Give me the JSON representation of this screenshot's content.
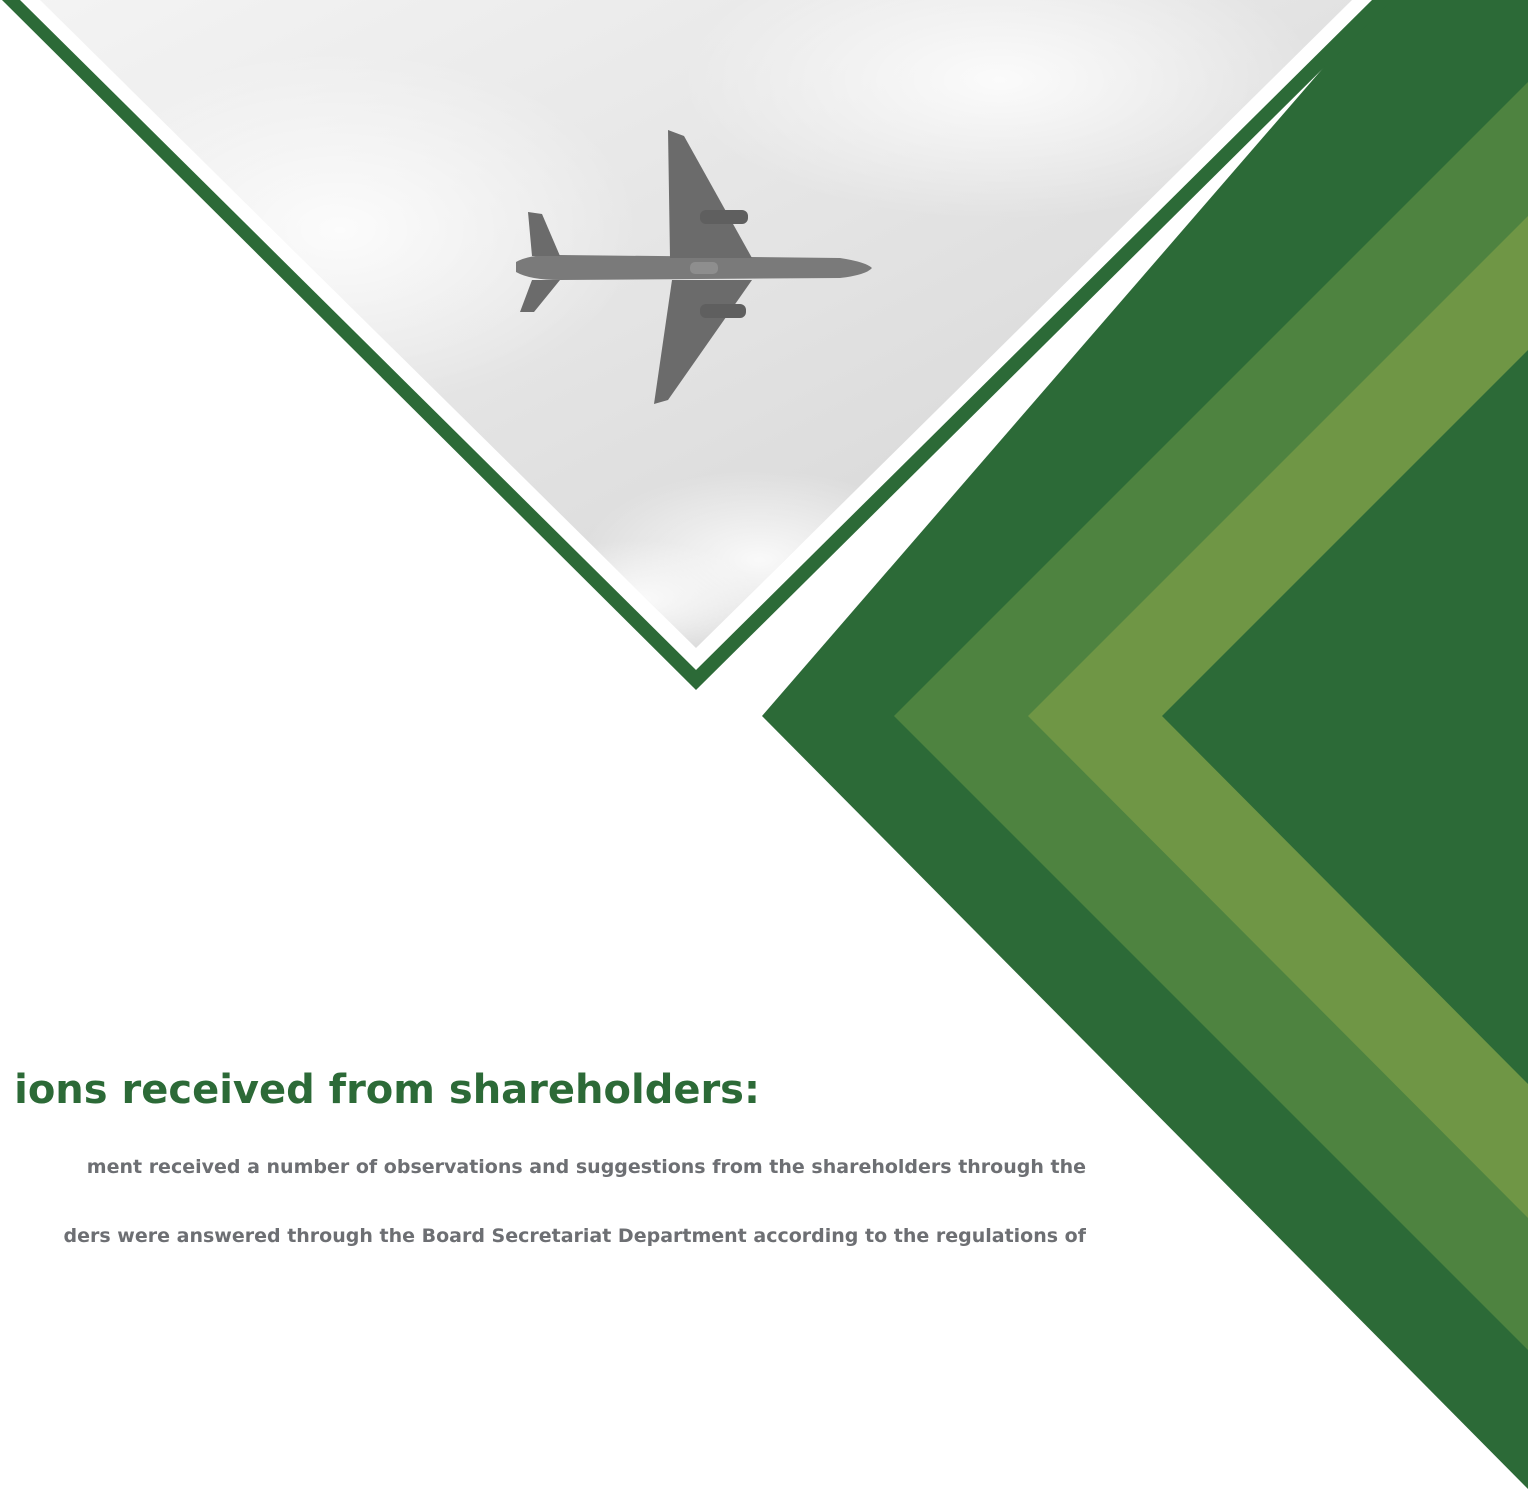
{
  "colors": {
    "dark_green": "#2c6a37",
    "mid_green": "#4e8340",
    "light_green": "#6f9645",
    "heading": "#2c6a37",
    "body_text": "#6d6f73",
    "photo_sky_light": "#f4f4f4",
    "photo_sky_dark": "#cfcfcf",
    "airplane": "#6b6b6b"
  },
  "photo": {
    "subject_icon": "airplane-icon",
    "tone": "grayscale"
  },
  "section": {
    "heading": "ions received from shareholders:",
    "paragraph_lines": [
      "ment received a number of observations and suggestions from the shareholders through the",
      "ders were answered through the Board Secretariat Department according to the regulations of"
    ]
  }
}
